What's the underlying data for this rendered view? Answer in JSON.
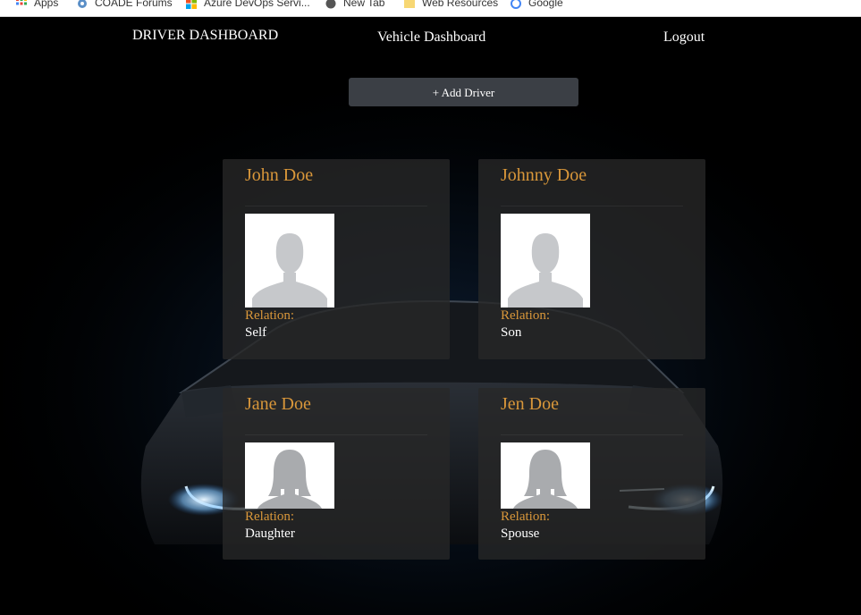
{
  "bookmarks": [
    {
      "label": "Apps",
      "icon": "apps-grid-icon"
    },
    {
      "label": "COADE Forums",
      "icon": "gear-icon"
    },
    {
      "label": "Azure DevOps Servi...",
      "icon": "windows-logo-icon"
    },
    {
      "label": "New Tab",
      "icon": "globe-icon"
    },
    {
      "label": "Web Resources",
      "icon": "folder-icon"
    },
    {
      "label": "Google",
      "icon": "google-icon"
    }
  ],
  "nav": {
    "brand": "DRIVER DASHBOARD",
    "vehicle_link": "Vehicle Dashboard",
    "logout": "Logout"
  },
  "add_driver_label": "+ Add Driver",
  "relation_label": "Relation:",
  "drivers": [
    {
      "name": "John Doe",
      "relation": "Self",
      "avatar": "male-avatar-icon"
    },
    {
      "name": "Johnny Doe",
      "relation": "Son",
      "avatar": "male-avatar-icon"
    },
    {
      "name": "Jane Doe",
      "relation": "Daughter",
      "avatar": "female-avatar-icon"
    },
    {
      "name": "Jen Doe",
      "relation": "Spouse",
      "avatar": "female-avatar-icon"
    }
  ],
  "colors": {
    "accent": "#d9973a",
    "background": "#000000",
    "card": "#282828",
    "button": "#3b3f45"
  }
}
